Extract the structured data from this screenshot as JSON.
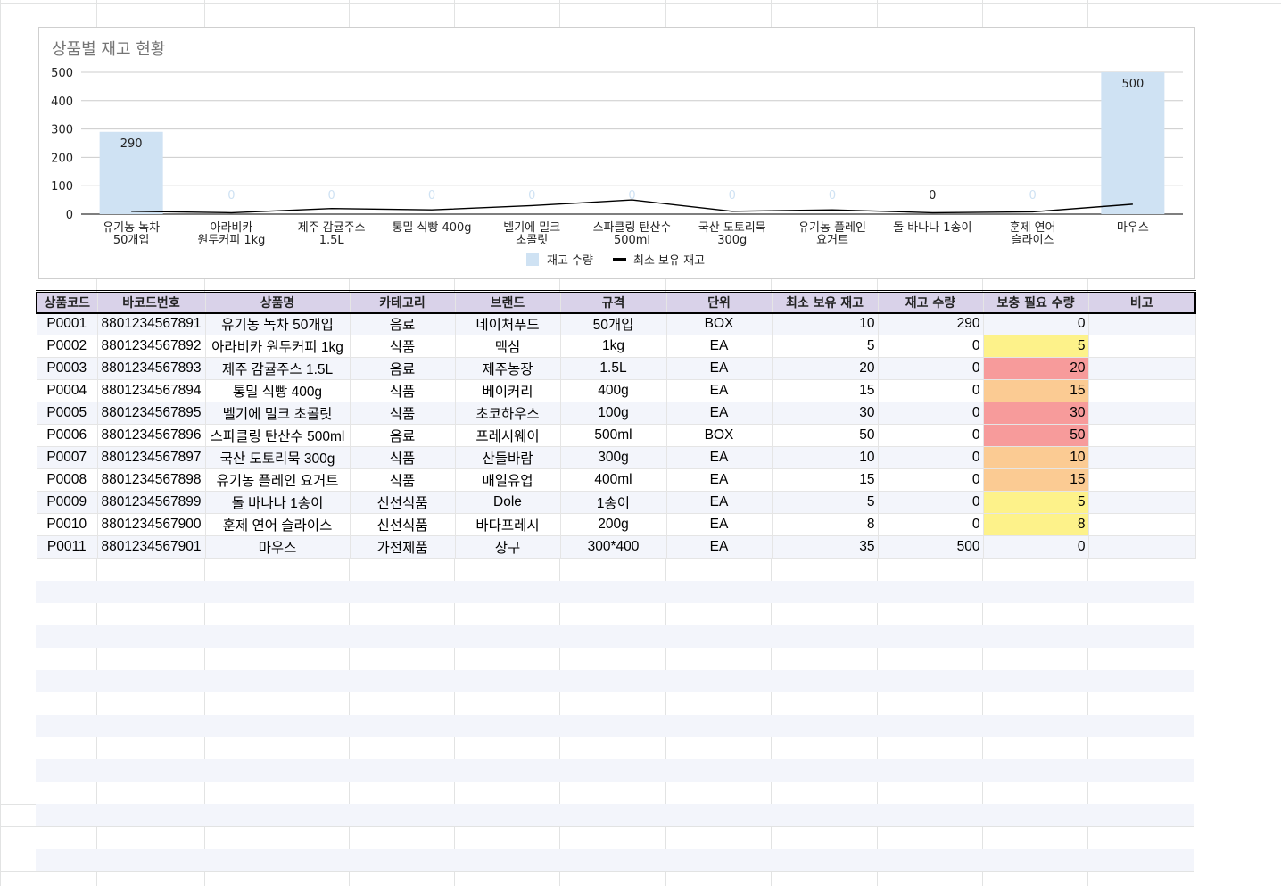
{
  "chart": {
    "title": "상품별 재고 현황",
    "y_ticks": [
      "500",
      "400",
      "300",
      "200",
      "100",
      "0"
    ],
    "legend": {
      "stock": "재고 수량",
      "min": "최소 보유 재고"
    },
    "colors": {
      "bar": "#cfe2f3",
      "line": "#000000",
      "zero_label": "#cfe2f3"
    }
  },
  "chart_data": {
    "type": "bar",
    "title": "상품별 재고 현황",
    "categories": [
      [
        "유기농 녹차",
        "50개입"
      ],
      [
        "아라비카",
        "원두커피 1kg"
      ],
      [
        "제주 감귤주스",
        "1.5L"
      ],
      [
        "통밀 식빵 400g"
      ],
      [
        "벨기에 밀크",
        "초콜릿"
      ],
      [
        "스파클링 탄산수",
        "500ml"
      ],
      [
        "국산 도토리묵",
        "300g"
      ],
      [
        "유기농 플레인",
        "요거트"
      ],
      [
        "돌 바나나 1송이"
      ],
      [
        "훈제 연어",
        "슬라이스"
      ],
      [
        "마우스"
      ]
    ],
    "series": [
      {
        "name": "재고 수량",
        "type": "bar",
        "values": [
          290,
          0,
          0,
          0,
          0,
          0,
          0,
          0,
          0,
          0,
          500
        ],
        "labels": [
          "290",
          "0",
          "0",
          "0",
          "0",
          "0",
          "0",
          "0",
          "0",
          "0",
          "500"
        ]
      },
      {
        "name": "최소 보유 재고",
        "type": "line",
        "values": [
          10,
          5,
          20,
          15,
          30,
          50,
          10,
          15,
          5,
          8,
          35
        ]
      }
    ],
    "ylim": [
      0,
      500
    ],
    "grid": true,
    "legend_position": "bottom"
  },
  "table": {
    "headers": [
      "상품코드",
      "바코드번호",
      "상품명",
      "카테고리",
      "브랜드",
      "규격",
      "단위",
      "최소 보유 재고",
      "재고 수량",
      "보충 필요 수량",
      "비고"
    ],
    "rows": [
      {
        "code": "P0001",
        "barcode": "8801234567891",
        "name": "유기농 녹차 50개입",
        "category": "음료",
        "brand": "네이처푸드",
        "spec": "50개입",
        "unit": "BOX",
        "min": "10",
        "stock": "290",
        "need": "0",
        "note": "",
        "need_level": "none"
      },
      {
        "code": "P0002",
        "barcode": "8801234567892",
        "name": "아라비카 원두커피 1kg",
        "category": "식품",
        "brand": "맥심",
        "spec": "1kg",
        "unit": "EA",
        "min": "5",
        "stock": "0",
        "need": "5",
        "note": "",
        "need_level": "yellow"
      },
      {
        "code": "P0003",
        "barcode": "8801234567893",
        "name": "제주 감귤주스 1.5L",
        "category": "음료",
        "brand": "제주농장",
        "spec": "1.5L",
        "unit": "EA",
        "min": "20",
        "stock": "0",
        "need": "20",
        "note": "",
        "need_level": "red"
      },
      {
        "code": "P0004",
        "barcode": "8801234567894",
        "name": "통밀 식빵 400g",
        "category": "식품",
        "brand": "베이커리",
        "spec": "400g",
        "unit": "EA",
        "min": "15",
        "stock": "0",
        "need": "15",
        "note": "",
        "need_level": "orange"
      },
      {
        "code": "P0005",
        "barcode": "8801234567895",
        "name": "벨기에 밀크 초콜릿",
        "category": "식품",
        "brand": "초코하우스",
        "spec": "100g",
        "unit": "EA",
        "min": "30",
        "stock": "0",
        "need": "30",
        "note": "",
        "need_level": "red"
      },
      {
        "code": "P0006",
        "barcode": "8801234567896",
        "name": "스파클링 탄산수 500ml",
        "category": "음료",
        "brand": "프레시웨이",
        "spec": "500ml",
        "unit": "BOX",
        "min": "50",
        "stock": "0",
        "need": "50",
        "note": "",
        "need_level": "red"
      },
      {
        "code": "P0007",
        "barcode": "8801234567897",
        "name": "국산 도토리묵 300g",
        "category": "식품",
        "brand": "산들바람",
        "spec": "300g",
        "unit": "EA",
        "min": "10",
        "stock": "0",
        "need": "10",
        "note": "",
        "need_level": "orange"
      },
      {
        "code": "P0008",
        "barcode": "8801234567898",
        "name": "유기농 플레인 요거트",
        "category": "식품",
        "brand": "매일유업",
        "spec": "400ml",
        "unit": "EA",
        "min": "15",
        "stock": "0",
        "need": "15",
        "note": "",
        "need_level": "orange"
      },
      {
        "code": "P0009",
        "barcode": "8801234567899",
        "name": "돌 바나나 1송이",
        "category": "신선식품",
        "brand": "Dole",
        "spec": "1송이",
        "unit": "EA",
        "min": "5",
        "stock": "0",
        "need": "5",
        "note": "",
        "need_level": "yellow"
      },
      {
        "code": "P0010",
        "barcode": "8801234567900",
        "name": "훈제 연어 슬라이스",
        "category": "신선식품",
        "brand": "바다프레시",
        "spec": "200g",
        "unit": "EA",
        "min": "8",
        "stock": "0",
        "need": "8",
        "note": "",
        "need_level": "yellow"
      },
      {
        "code": "P0011",
        "barcode": "8801234567901",
        "name": "마우스",
        "category": "가전제품",
        "brand": "상구",
        "spec": "300*400",
        "unit": "EA",
        "min": "35",
        "stock": "500",
        "need": "0",
        "note": "",
        "need_level": "none"
      }
    ]
  }
}
